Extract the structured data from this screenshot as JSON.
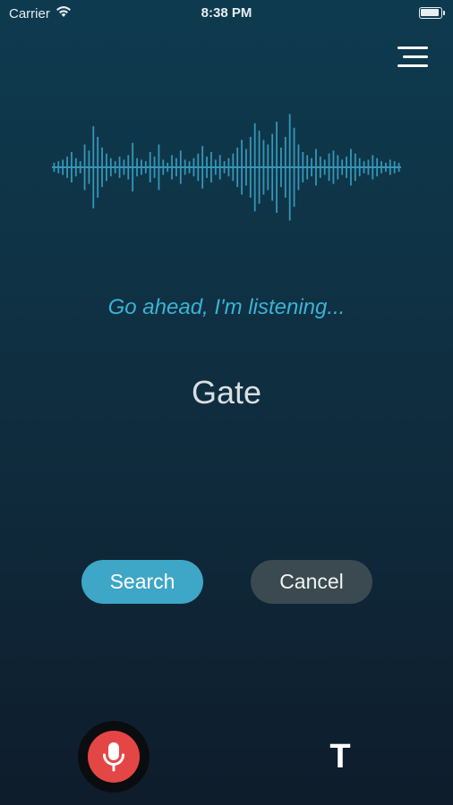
{
  "status_bar": {
    "carrier": "Carrier",
    "time": "8:38 PM"
  },
  "icons": {
    "wifi": "wifi-icon",
    "battery": "battery-icon",
    "menu": "hamburger-menu-icon",
    "waveform": "audio-waveform",
    "microphone": "microphone-icon",
    "text_mode": "text-mode-icon"
  },
  "main": {
    "prompt": "Go ahead, I'm listening...",
    "transcript": "Gate"
  },
  "actions": {
    "search_label": "Search",
    "cancel_label": "Cancel"
  },
  "bottom_bar": {
    "text_toggle_label": "T"
  },
  "colors": {
    "accent": "#3bb3d6",
    "search_button": "#3ea6c6",
    "cancel_button": "#3b4a50",
    "mic_button": "#e44646",
    "waveform": "#3596b8"
  }
}
